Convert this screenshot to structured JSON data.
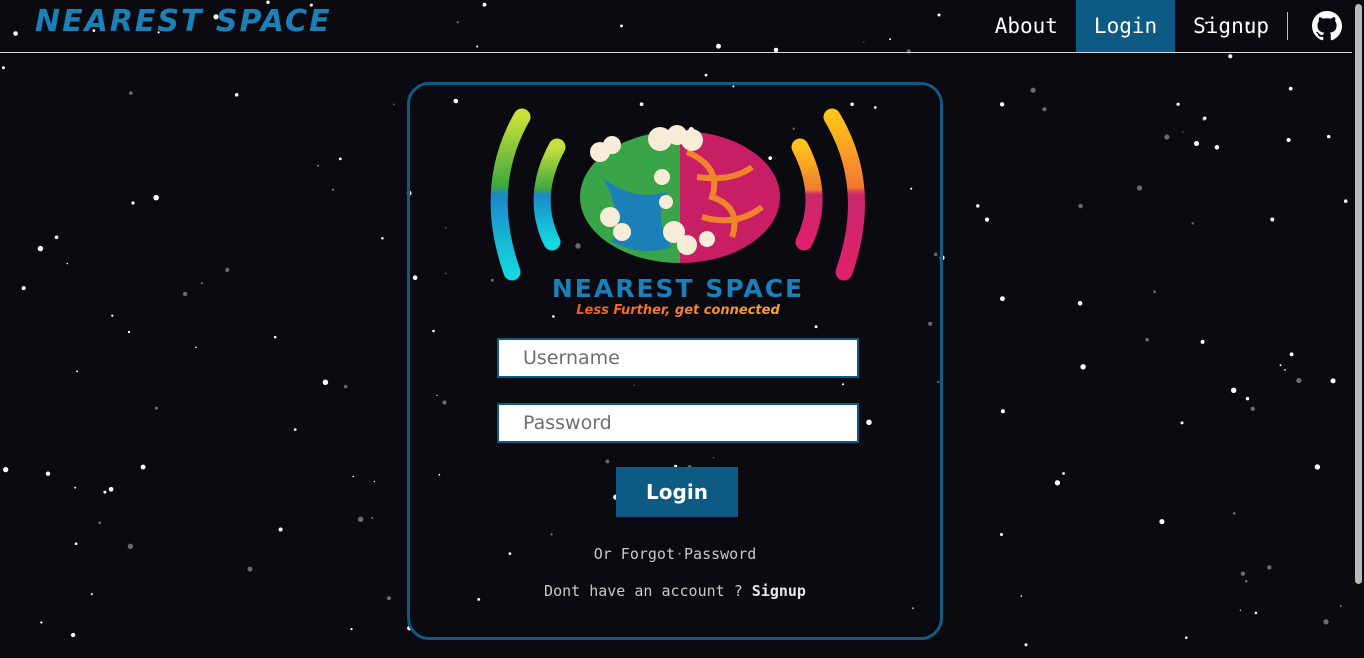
{
  "brand": {
    "name": "NEAREST SPACE"
  },
  "nav": {
    "about": "About",
    "login": "Login",
    "signup": "Signup",
    "github_icon": "github-icon"
  },
  "logo": {
    "title": "NEAREST SPACE",
    "tagline": "Less Further, get connected"
  },
  "form": {
    "username_placeholder": "Username",
    "password_placeholder": "Password",
    "login_label": "Login",
    "forgot_text": "Or Forgot Password",
    "no_account_text": "Dont have an account ?",
    "signup_link": "Signup"
  },
  "colors": {
    "brand_blue": "#1b80b8",
    "accent": "#0d5a84",
    "card_border": "#0f5b82",
    "background": "#0a0a10"
  }
}
